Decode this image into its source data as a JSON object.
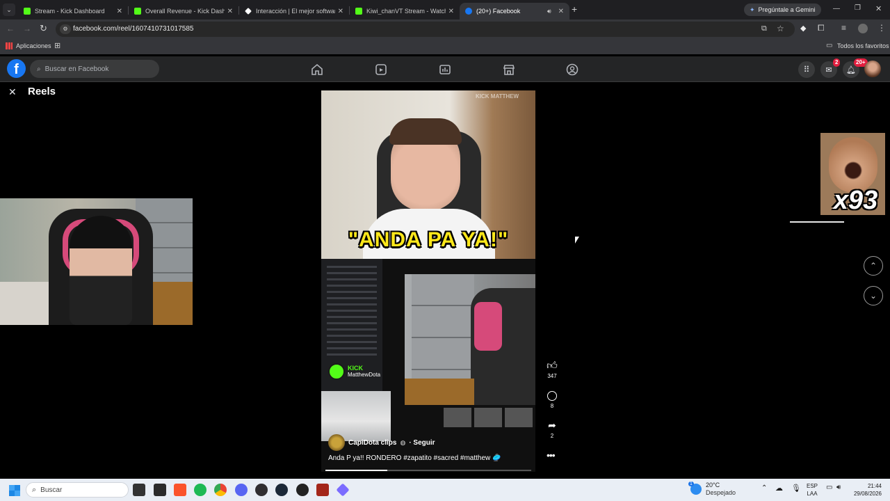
{
  "browser": {
    "tabs": [
      {
        "title": "Stream - Kick Dashboard",
        "favicon": "kick-icon",
        "color": "#53fc18"
      },
      {
        "title": "Overall Revenue - Kick Dashboard",
        "favicon": "kick-icon",
        "color": "#53fc18"
      },
      {
        "title": "Interacción | El mejor software",
        "favicon": "diamond-icon",
        "color": "#ffffff"
      },
      {
        "title": "Kiwi_chanVT Stream - Watch Live",
        "favicon": "kick-icon",
        "color": "#53fc18"
      },
      {
        "title": "(20+) Facebook",
        "favicon": "facebook-icon",
        "color": "#1877f2"
      }
    ],
    "gemini_label": "Pregúntale a Gemini",
    "url": "facebook.com/reel/1607410731017585",
    "bookmarks": {
      "apps_label": "Aplicaciones",
      "all_favorites": "Todos los favoritos"
    }
  },
  "facebook": {
    "search_placeholder": "Buscar en Facebook",
    "messenger_badge": "2",
    "notifications_badge": "20+",
    "reels_title": "Reels",
    "reel": {
      "overlay_caption": "\"ANDA PA YA!\"",
      "watermark": "KICK MATTHEW",
      "kick_logo": "KICK",
      "kick_channel": "MatthewDota",
      "author": "CapiDota clips",
      "follow_label": "· Seguir",
      "description": "Anda P ya!! RONDERO #zapatito #sacred #matthew 🥏",
      "likes": "347",
      "comments": "8",
      "shares": "2",
      "emote_label": "x93",
      "progress": 0.3
    }
  },
  "taskbar": {
    "search_placeholder": "Buscar",
    "weather_temp": "20°C",
    "weather_desc": "Despejado",
    "weather_badge": "1",
    "lang_top": "ESP",
    "lang_bottom": "LAA",
    "time": "21:44",
    "date": "29/08/2026"
  }
}
